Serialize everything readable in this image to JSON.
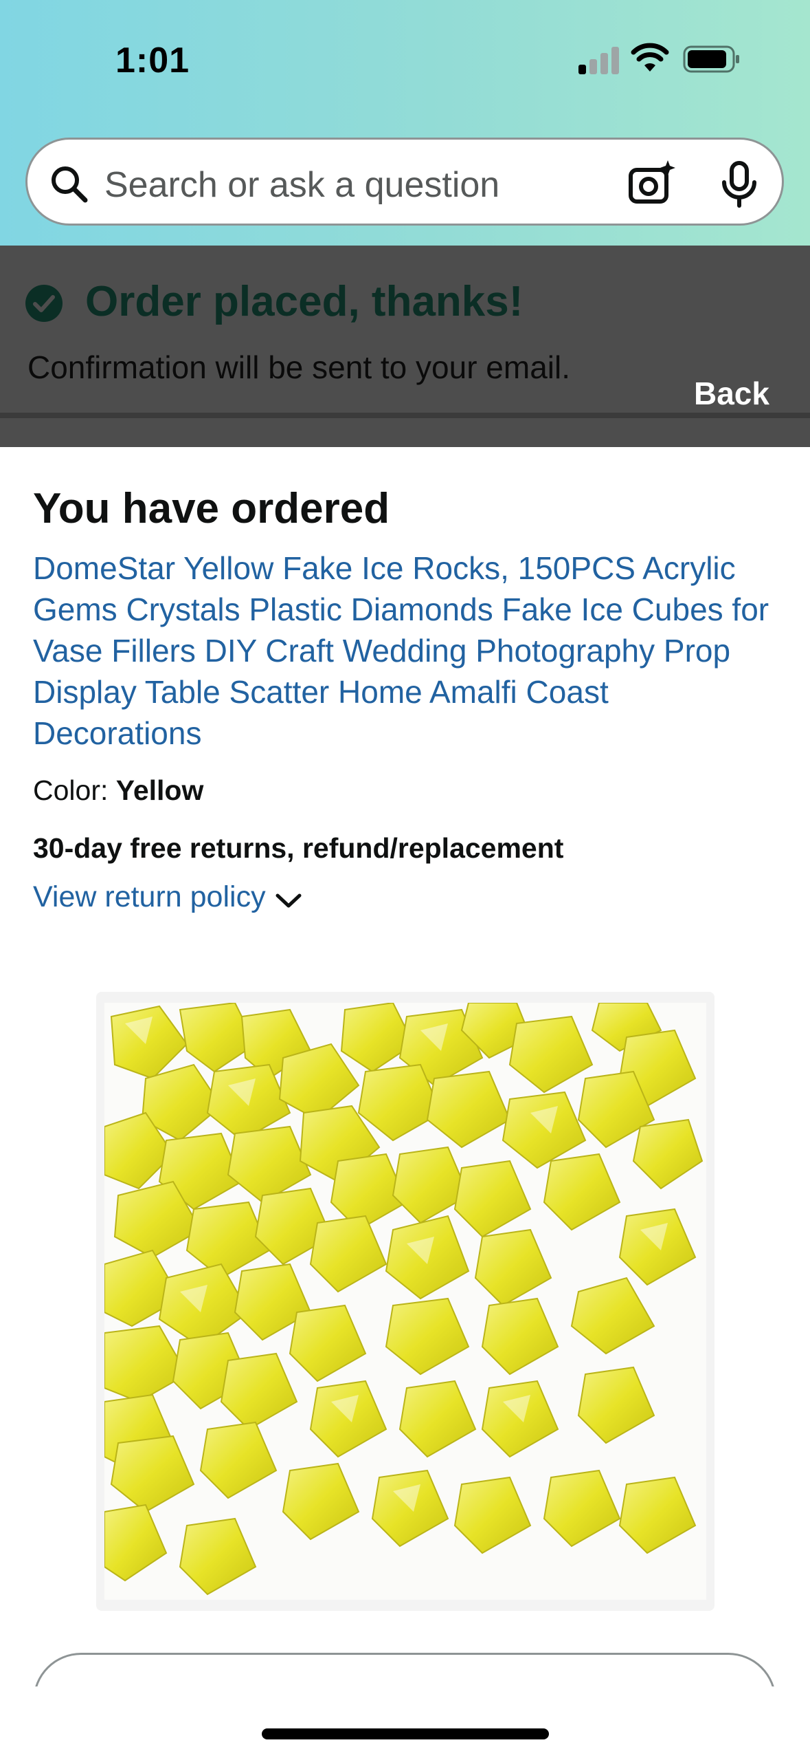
{
  "status_bar": {
    "time": "1:01"
  },
  "search": {
    "placeholder": "Search or ask a question"
  },
  "banner": {
    "title": "Order placed, thanks!",
    "subtitle": "Confirmation will be sent to your email.",
    "back_label": "Back",
    "check_color": "#067d62"
  },
  "order": {
    "heading": "You have ordered",
    "product_title": "DomeStar Yellow Fake Ice Rocks, 150PCS Acrylic Gems Crystals Plastic Diamonds Fake Ice Cubes for Vase Fillers DIY Craft Wedding Photography Prop Display Table Scatter Home Amalfi Coast Decorations",
    "color_label": "Color: ",
    "color_value": "Yellow",
    "returns_text": "30-day free returns, refund/replacement",
    "return_policy_link": "View return policy"
  },
  "colors": {
    "link": "#2162a1",
    "header_gradient_start": "#81d6e3",
    "header_gradient_end": "#a5e6cf",
    "overlay": "#4d4d4d"
  },
  "icons": {
    "search": "search-icon",
    "camera": "camera-icon",
    "mic": "mic-icon",
    "check": "check-circle-icon",
    "chevron": "chevron-down-icon"
  }
}
